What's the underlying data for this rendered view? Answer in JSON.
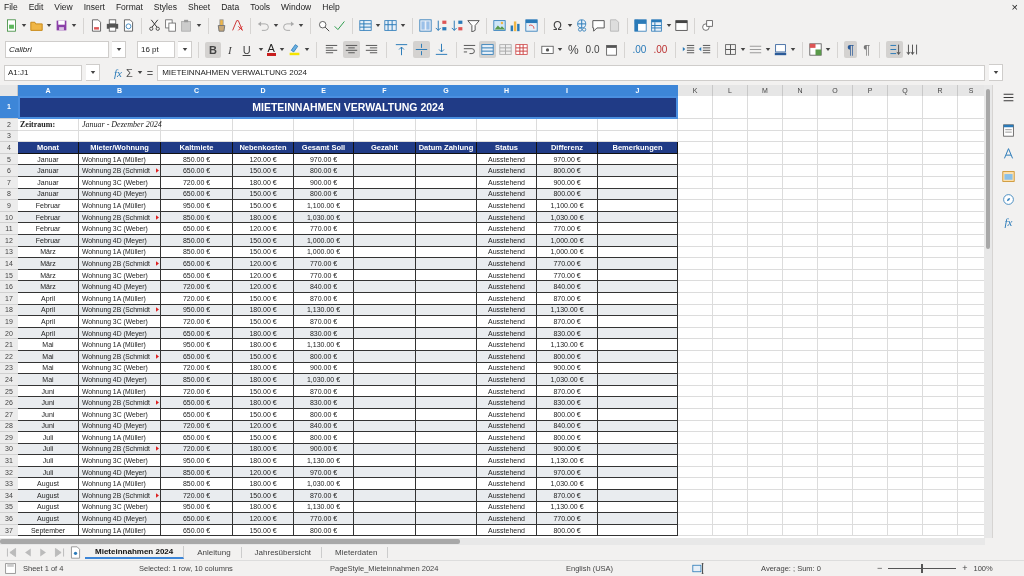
{
  "menu": [
    "File",
    "Edit",
    "View",
    "Insert",
    "Format",
    "Styles",
    "Sheet",
    "Data",
    "Tools",
    "Window",
    "Help"
  ],
  "close_label": "×",
  "toolbar": {
    "special_character": "Ω",
    "percent": "%",
    "decimal": "0.0",
    "add_decimal": ".00",
    "delete_decimal": ".00",
    "paragraph_ltr": "¶",
    "paragraph_rtl": "¶",
    "font_name": "Calibri",
    "font_size": "16 pt",
    "format_buttons": [
      {
        "label": "B",
        "kind": "bold",
        "selected": true
      },
      {
        "label": "I",
        "kind": "italic",
        "selected": false
      },
      {
        "label": "U",
        "kind": "underline",
        "selected": false
      }
    ],
    "font_color_label": "A",
    "horizontal_align_buttons": [
      {
        "kind": "left",
        "selected": false
      },
      {
        "kind": "center",
        "selected": true
      },
      {
        "kind": "right",
        "selected": false
      }
    ],
    "vertical_align_buttons": [
      {
        "kind": "top",
        "selected": false
      },
      {
        "kind": "middle",
        "selected": true
      },
      {
        "kind": "bottom",
        "selected": false
      }
    ],
    "merge_and_center": true,
    "left_to_right": true,
    "stacked_text": true
  },
  "formula_bar": {
    "cell_reference": "A1:J1",
    "function_label": "fx",
    "sum_label": "Σ",
    "equals_label": "=",
    "content": "MIETEINNAHMEN VERWALTUNG 2024"
  },
  "columns": [
    {
      "label": "A",
      "selected": true
    },
    {
      "label": "B",
      "selected": true
    },
    {
      "label": "C",
      "selected": true
    },
    {
      "label": "D",
      "selected": true
    },
    {
      "label": "E",
      "selected": true
    },
    {
      "label": "F",
      "selected": true
    },
    {
      "label": "G",
      "selected": true
    },
    {
      "label": "H",
      "selected": true
    },
    {
      "label": "I",
      "selected": true
    },
    {
      "label": "J",
      "selected": true
    },
    {
      "label": "K",
      "selected": false
    },
    {
      "label": "L",
      "selected": false
    },
    {
      "label": "M",
      "selected": false
    },
    {
      "label": "N",
      "selected": false
    },
    {
      "label": "O",
      "selected": false
    },
    {
      "label": "P",
      "selected": false
    },
    {
      "label": "Q",
      "selected": false
    },
    {
      "label": "R",
      "selected": false
    },
    {
      "label": "S",
      "selected": false
    }
  ],
  "title_row": {
    "row": "1",
    "selected": true,
    "text": "MIETEINNAHMEN VERWALTUNG 2024"
  },
  "period_row": {
    "row": "2",
    "selected": false,
    "label": "Zeitraum:",
    "value": "Januar - Dezember 2024"
  },
  "empty_row": {
    "row": "3",
    "selected": false
  },
  "header_row": {
    "row": "4",
    "selected": false,
    "labels": [
      "Monat",
      "Mieter/Wohnung",
      "Kaltmiete",
      "Nebenkosten",
      "Gesamt Soll",
      "Gezahlt",
      "Datum Zahlung",
      "Status",
      "Differenz",
      "Bemerkungen"
    ]
  },
  "rows": [
    {
      "row": "5",
      "selected": false,
      "month": "Januar",
      "tenant": "Wohnung 1A (Müller)",
      "tenant_overflow": false,
      "cold_rent": "850.00 €",
      "utilities": "120.00 €",
      "total": "970.00 €",
      "status": "Ausstehend",
      "difference": "970.00 €"
    },
    {
      "row": "6",
      "selected": false,
      "month": "Januar",
      "tenant": "Wohnung 2B (Schmidt",
      "tenant_overflow": true,
      "cold_rent": "650.00 €",
      "utilities": "150.00 €",
      "total": "800.00 €",
      "status": "Ausstehend",
      "difference": "800.00 €"
    },
    {
      "row": "7",
      "selected": false,
      "month": "Januar",
      "tenant": "Wohnung 3C (Weber)",
      "tenant_overflow": false,
      "cold_rent": "720.00 €",
      "utilities": "180.00 €",
      "total": "900.00 €",
      "status": "Ausstehend",
      "difference": "900.00 €"
    },
    {
      "row": "8",
      "selected": false,
      "month": "Januar",
      "tenant": "Wohnung 4D (Meyer)",
      "tenant_overflow": false,
      "cold_rent": "650.00 €",
      "utilities": "150.00 €",
      "total": "800.00 €",
      "status": "Ausstehend",
      "difference": "800.00 €"
    },
    {
      "row": "9",
      "selected": false,
      "month": "Februar",
      "tenant": "Wohnung 1A (Müller)",
      "tenant_overflow": false,
      "cold_rent": "950.00 €",
      "utilities": "150.00 €",
      "total": "1,100.00 €",
      "status": "Ausstehend",
      "difference": "1,100.00 €"
    },
    {
      "row": "10",
      "selected": false,
      "month": "Februar",
      "tenant": "Wohnung 2B (Schmidt",
      "tenant_overflow": true,
      "cold_rent": "850.00 €",
      "utilities": "180.00 €",
      "total": "1,030.00 €",
      "status": "Ausstehend",
      "difference": "1,030.00 €"
    },
    {
      "row": "11",
      "selected": false,
      "month": "Februar",
      "tenant": "Wohnung 3C (Weber)",
      "tenant_overflow": false,
      "cold_rent": "650.00 €",
      "utilities": "120.00 €",
      "total": "770.00 €",
      "status": "Ausstehend",
      "difference": "770.00 €"
    },
    {
      "row": "12",
      "selected": false,
      "month": "Februar",
      "tenant": "Wohnung 4D (Meyer)",
      "tenant_overflow": false,
      "cold_rent": "850.00 €",
      "utilities": "150.00 €",
      "total": "1,000.00 €",
      "status": "Ausstehend",
      "difference": "1,000.00 €"
    },
    {
      "row": "13",
      "selected": false,
      "month": "März",
      "tenant": "Wohnung 1A (Müller)",
      "tenant_overflow": false,
      "cold_rent": "850.00 €",
      "utilities": "150.00 €",
      "total": "1,000.00 €",
      "status": "Ausstehend",
      "difference": "1,000.00 €"
    },
    {
      "row": "14",
      "selected": false,
      "month": "März",
      "tenant": "Wohnung 2B (Schmidt",
      "tenant_overflow": true,
      "cold_rent": "650.00 €",
      "utilities": "120.00 €",
      "total": "770.00 €",
      "status": "Ausstehend",
      "difference": "770.00 €"
    },
    {
      "row": "15",
      "selected": false,
      "month": "März",
      "tenant": "Wohnung 3C (Weber)",
      "tenant_overflow": false,
      "cold_rent": "650.00 €",
      "utilities": "120.00 €",
      "total": "770.00 €",
      "status": "Ausstehend",
      "difference": "770.00 €"
    },
    {
      "row": "16",
      "selected": false,
      "month": "März",
      "tenant": "Wohnung 4D (Meyer)",
      "tenant_overflow": false,
      "cold_rent": "720.00 €",
      "utilities": "120.00 €",
      "total": "840.00 €",
      "status": "Ausstehend",
      "difference": "840.00 €"
    },
    {
      "row": "17",
      "selected": false,
      "month": "April",
      "tenant": "Wohnung 1A (Müller)",
      "tenant_overflow": false,
      "cold_rent": "720.00 €",
      "utilities": "150.00 €",
      "total": "870.00 €",
      "status": "Ausstehend",
      "difference": "870.00 €"
    },
    {
      "row": "18",
      "selected": false,
      "month": "April",
      "tenant": "Wohnung 2B (Schmidt",
      "tenant_overflow": true,
      "cold_rent": "950.00 €",
      "utilities": "180.00 €",
      "total": "1,130.00 €",
      "status": "Ausstehend",
      "difference": "1,130.00 €"
    },
    {
      "row": "19",
      "selected": false,
      "month": "April",
      "tenant": "Wohnung 3C (Weber)",
      "tenant_overflow": false,
      "cold_rent": "720.00 €",
      "utilities": "150.00 €",
      "total": "870.00 €",
      "status": "Ausstehend",
      "difference": "870.00 €"
    },
    {
      "row": "20",
      "selected": false,
      "month": "April",
      "tenant": "Wohnung 4D (Meyer)",
      "tenant_overflow": false,
      "cold_rent": "650.00 €",
      "utilities": "180.00 €",
      "total": "830.00 €",
      "status": "Ausstehend",
      "difference": "830.00 €"
    },
    {
      "row": "21",
      "selected": false,
      "month": "Mai",
      "tenant": "Wohnung 1A (Müller)",
      "tenant_overflow": false,
      "cold_rent": "950.00 €",
      "utilities": "180.00 €",
      "total": "1,130.00 €",
      "status": "Ausstehend",
      "difference": "1,130.00 €"
    },
    {
      "row": "22",
      "selected": false,
      "month": "Mai",
      "tenant": "Wohnung 2B (Schmidt",
      "tenant_overflow": true,
      "cold_rent": "650.00 €",
      "utilities": "150.00 €",
      "total": "800.00 €",
      "status": "Ausstehend",
      "difference": "800.00 €"
    },
    {
      "row": "23",
      "selected": false,
      "month": "Mai",
      "tenant": "Wohnung 3C (Weber)",
      "tenant_overflow": false,
      "cold_rent": "720.00 €",
      "utilities": "180.00 €",
      "total": "900.00 €",
      "status": "Ausstehend",
      "difference": "900.00 €"
    },
    {
      "row": "24",
      "selected": false,
      "month": "Mai",
      "tenant": "Wohnung 4D (Meyer)",
      "tenant_overflow": false,
      "cold_rent": "850.00 €",
      "utilities": "180.00 €",
      "total": "1,030.00 €",
      "status": "Ausstehend",
      "difference": "1,030.00 €"
    },
    {
      "row": "25",
      "selected": false,
      "month": "Juni",
      "tenant": "Wohnung 1A (Müller)",
      "tenant_overflow": false,
      "cold_rent": "720.00 €",
      "utilities": "150.00 €",
      "total": "870.00 €",
      "status": "Ausstehend",
      "difference": "870.00 €"
    },
    {
      "row": "26",
      "selected": false,
      "month": "Juni",
      "tenant": "Wohnung 2B (Schmidt",
      "tenant_overflow": true,
      "cold_rent": "650.00 €",
      "utilities": "180.00 €",
      "total": "830.00 €",
      "status": "Ausstehend",
      "difference": "830.00 €"
    },
    {
      "row": "27",
      "selected": false,
      "month": "Juni",
      "tenant": "Wohnung 3C (Weber)",
      "tenant_overflow": false,
      "cold_rent": "650.00 €",
      "utilities": "150.00 €",
      "total": "800.00 €",
      "status": "Ausstehend",
      "difference": "800.00 €"
    },
    {
      "row": "28",
      "selected": false,
      "month": "Juni",
      "tenant": "Wohnung 4D (Meyer)",
      "tenant_overflow": false,
      "cold_rent": "720.00 €",
      "utilities": "120.00 €",
      "total": "840.00 €",
      "status": "Ausstehend",
      "difference": "840.00 €"
    },
    {
      "row": "29",
      "selected": false,
      "month": "Juli",
      "tenant": "Wohnung 1A (Müller)",
      "tenant_overflow": false,
      "cold_rent": "650.00 €",
      "utilities": "150.00 €",
      "total": "800.00 €",
      "status": "Ausstehend",
      "difference": "800.00 €"
    },
    {
      "row": "30",
      "selected": false,
      "month": "Juli",
      "tenant": "Wohnung 2B (Schmidt",
      "tenant_overflow": true,
      "cold_rent": "720.00 €",
      "utilities": "180.00 €",
      "total": "900.00 €",
      "status": "Ausstehend",
      "difference": "900.00 €"
    },
    {
      "row": "31",
      "selected": false,
      "month": "Juli",
      "tenant": "Wohnung 3C (Weber)",
      "tenant_overflow": false,
      "cold_rent": "950.00 €",
      "utilities": "180.00 €",
      "total": "1,130.00 €",
      "status": "Ausstehend",
      "difference": "1,130.00 €"
    },
    {
      "row": "32",
      "selected": false,
      "month": "Juli",
      "tenant": "Wohnung 4D (Meyer)",
      "tenant_overflow": false,
      "cold_rent": "850.00 €",
      "utilities": "120.00 €",
      "total": "970.00 €",
      "status": "Ausstehend",
      "difference": "970.00 €"
    },
    {
      "row": "33",
      "selected": false,
      "month": "August",
      "tenant": "Wohnung 1A (Müller)",
      "tenant_overflow": false,
      "cold_rent": "850.00 €",
      "utilities": "180.00 €",
      "total": "1,030.00 €",
      "status": "Ausstehend",
      "difference": "1,030.00 €"
    },
    {
      "row": "34",
      "selected": false,
      "month": "August",
      "tenant": "Wohnung 2B (Schmidt",
      "tenant_overflow": true,
      "cold_rent": "720.00 €",
      "utilities": "150.00 €",
      "total": "870.00 €",
      "status": "Ausstehend",
      "difference": "870.00 €"
    },
    {
      "row": "35",
      "selected": false,
      "month": "August",
      "tenant": "Wohnung 3C (Weber)",
      "tenant_overflow": false,
      "cold_rent": "950.00 €",
      "utilities": "180.00 €",
      "total": "1,130.00 €",
      "status": "Ausstehend",
      "difference": "1,130.00 €"
    },
    {
      "row": "36",
      "selected": false,
      "month": "August",
      "tenant": "Wohnung 4D (Meyer)",
      "tenant_overflow": false,
      "cold_rent": "650.00 €",
      "utilities": "120.00 €",
      "total": "770.00 €",
      "status": "Ausstehend",
      "difference": "770.00 €"
    },
    {
      "row": "37",
      "selected": false,
      "month": "September",
      "tenant": "Wohnung 1A (Müller)",
      "tenant_overflow": false,
      "cold_rent": "650.00 €",
      "utilities": "150.00 €",
      "total": "800.00 €",
      "status": "Ausstehend",
      "difference": "800.00 €"
    }
  ],
  "sheet_tabs": [
    {
      "label": "Mieteinnahmen 2024",
      "selected": true
    },
    {
      "label": "Anleitung",
      "selected": false
    },
    {
      "label": "Jahresübersicht",
      "selected": false
    },
    {
      "label": "Mieterdaten",
      "selected": false
    }
  ],
  "sidebar_functions_label": "fx",
  "status_bar": {
    "sheet": "Sheet 1 of 4",
    "selection": "Selected: 1 row, 10 columns",
    "page_style": "PageStyle_Mieteinnahmen 2024",
    "language": "English (USA)",
    "summary": "Average: ; Sum: 0",
    "zoom_out": "−",
    "zoom_in": "+",
    "zoom": "100%",
    "zoom_slider": {
      "level": 0.5
    }
  }
}
